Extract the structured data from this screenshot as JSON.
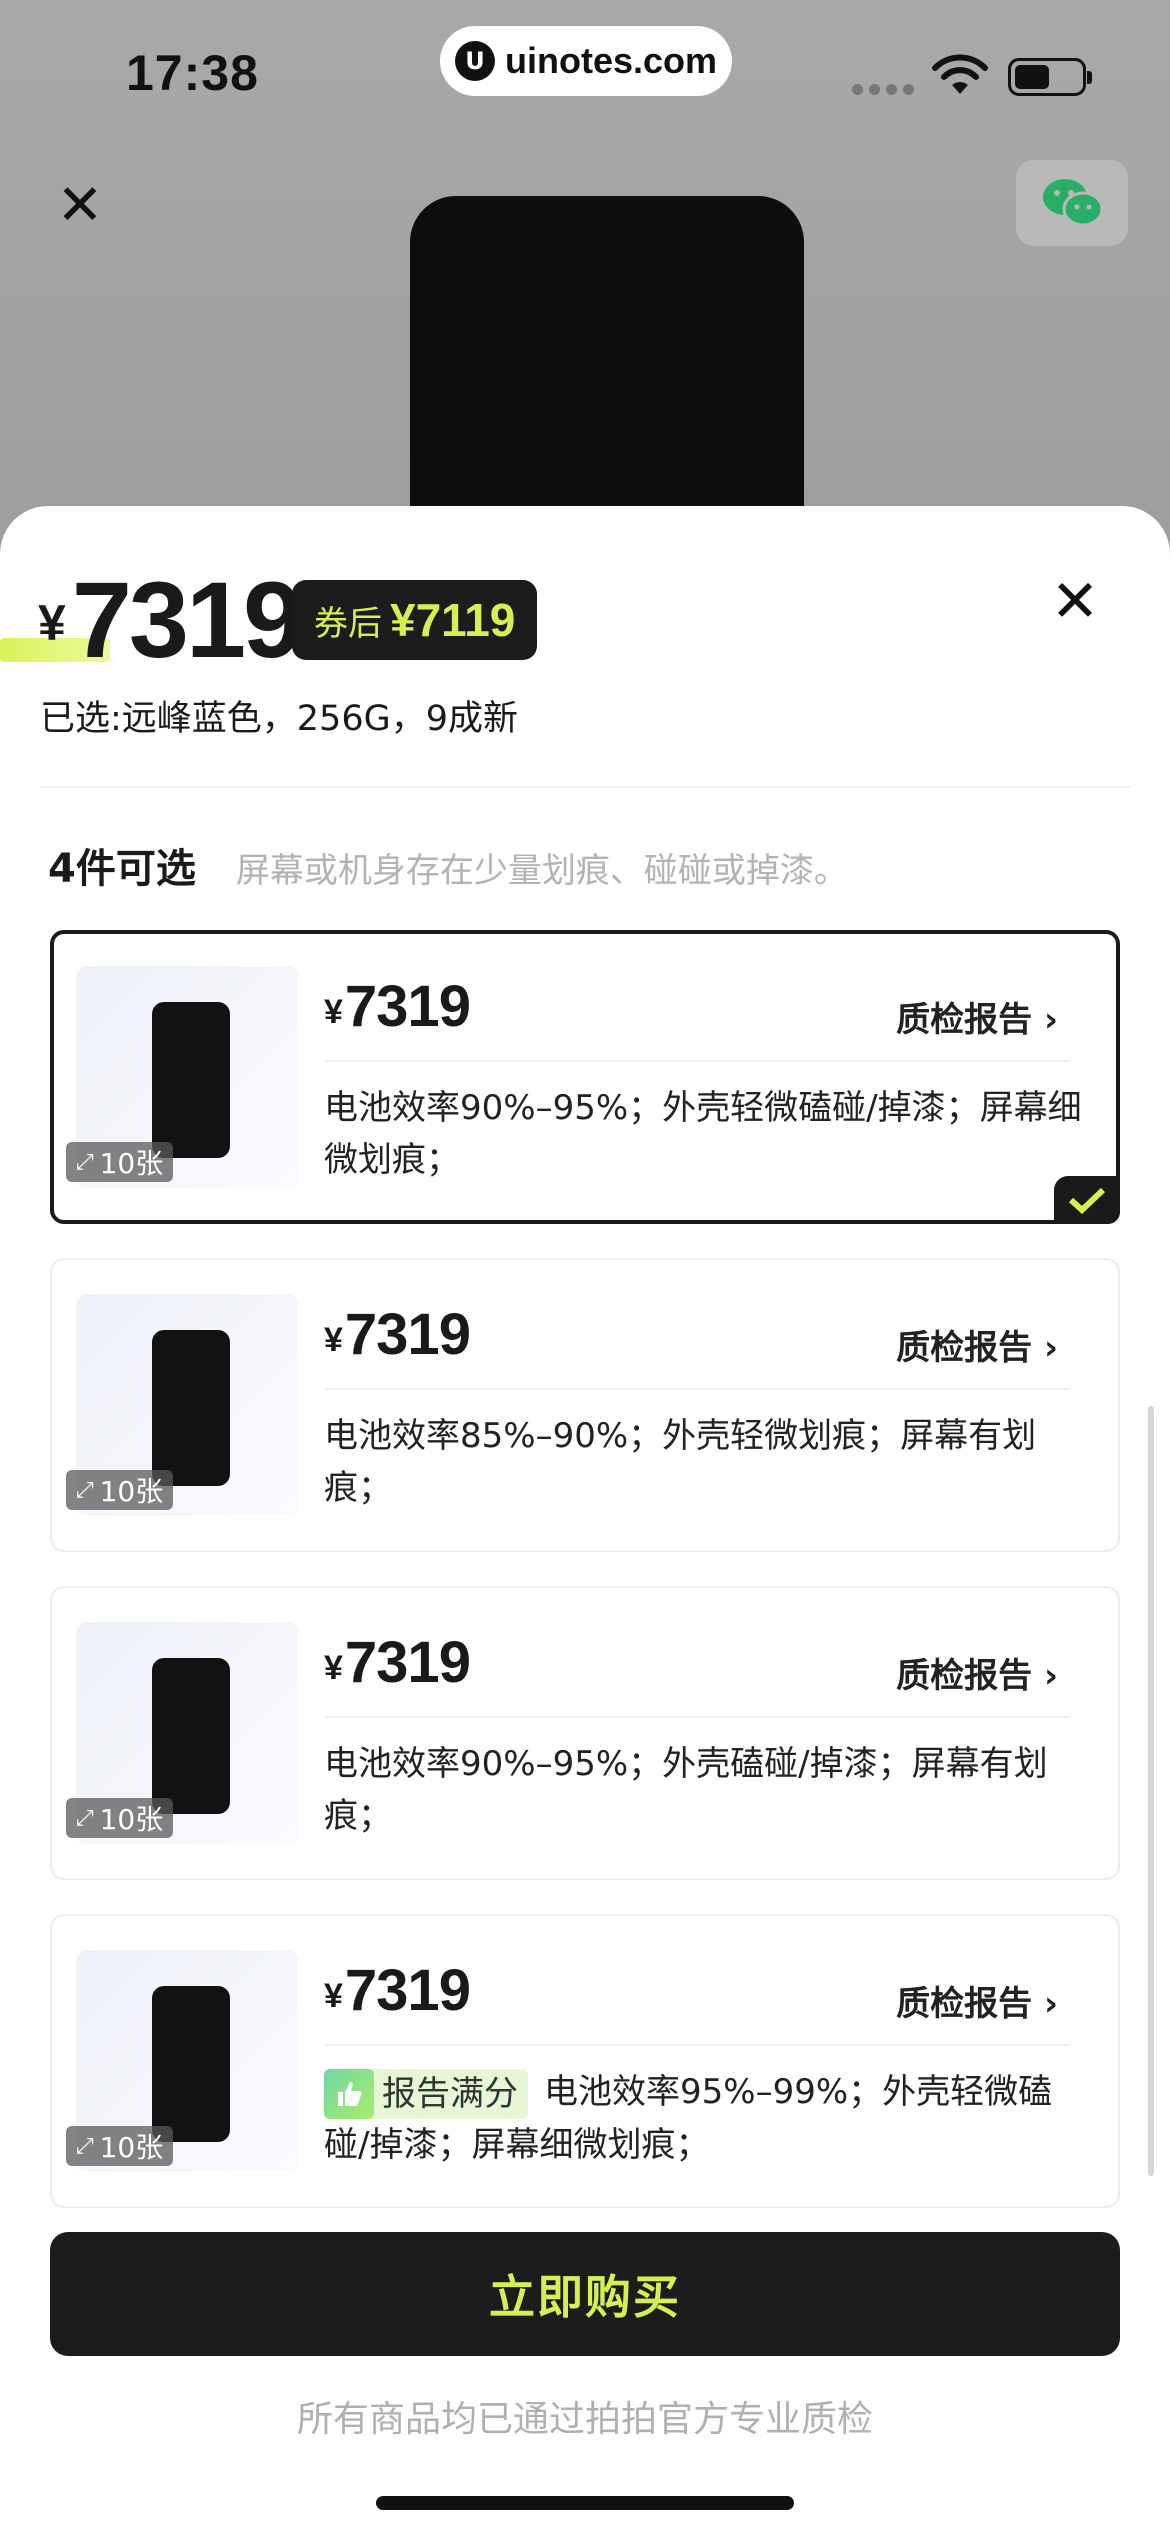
{
  "status_bar": {
    "time": "17:38",
    "watermark": "uinotes.com",
    "watermark_icon": "u-logo-icon",
    "icons": [
      "signal-icon",
      "wifi-icon",
      "battery-icon"
    ]
  },
  "background": {
    "close_icon": "close-icon",
    "share_icon": "wechat-icon",
    "close_symbol": "✕"
  },
  "sheet": {
    "currency": "¥",
    "price": "7319",
    "coupon_label": "券后",
    "coupon_price": "¥7119",
    "close_symbol": "✕",
    "selected_summary": "已选:远峰蓝色，256G，9成新",
    "available_count": "4件可选",
    "available_note": "屏幕或机身存在少量划痕、碰碰或掉漆。",
    "items": [
      {
        "currency": "¥",
        "price": "7319",
        "photos": "10张",
        "report_link": "质检报告 ›",
        "description": "电池效率90%–95%；外壳轻微磕碰/掉漆；屏幕细微划痕；",
        "selected": true
      },
      {
        "currency": "¥",
        "price": "7319",
        "photos": "10张",
        "report_link": "质检报告 ›",
        "description": "电池效率85%–90%；外壳轻微划痕；屏幕有划痕；",
        "selected": false
      },
      {
        "currency": "¥",
        "price": "7319",
        "photos": "10张",
        "report_link": "质检报告 ›",
        "description": "电池效率90%–95%；外壳磕碰/掉漆；屏幕有划痕；",
        "selected": false
      },
      {
        "currency": "¥",
        "price": "7319",
        "photos": "10张",
        "report_link": "质检报告 ›",
        "badge": "报告满分",
        "description": "电池效率95%–99%；外壳轻微磕碰/掉漆；屏幕细微划痕；",
        "selected": false
      }
    ],
    "buy_button": "立即购买",
    "footer_note": "所有商品均已通过拍拍官方专业质检"
  },
  "colors": {
    "accent_lime": "#d4f053",
    "dark": "#1c1c1c",
    "badge_bg": "#e5f7d4"
  }
}
